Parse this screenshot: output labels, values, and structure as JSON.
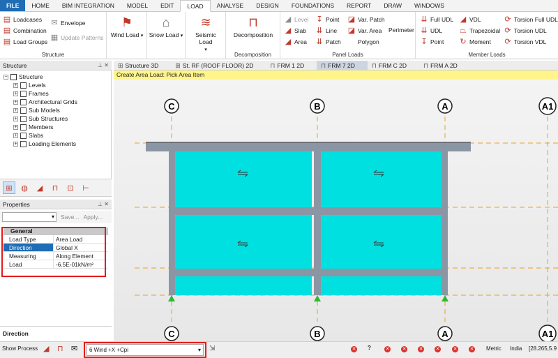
{
  "tabs": [
    "FILE",
    "HOME",
    "BIM INTEGRATION",
    "MODEL",
    "EDIT",
    "LOAD",
    "ANALYSE",
    "DESIGN",
    "FOUNDATIONS",
    "REPORT",
    "DRAW",
    "WINDOWS"
  ],
  "ribbon": {
    "structure": {
      "label": "Structure",
      "loadcases": "Loadcases",
      "combination": "Combination",
      "load_groups": "Load Groups",
      "envelope": "Envelope",
      "update_patterns": "Update Patterns"
    },
    "wind_load": "Wind Load",
    "snow_load": "Snow Load",
    "seismic_load": "Seismic Load",
    "decomposition": {
      "label": "Decomposition",
      "button": "Decomposition"
    },
    "panel_loads": {
      "label": "Panel Loads",
      "level": "Level",
      "slab": "Slab",
      "area": "Area",
      "point": "Point",
      "line": "Line",
      "patch": "Patch",
      "var_patch": "Var. Patch",
      "var_area": "Var. Area",
      "polygon": "Polygon",
      "perimeter": "Perimeter"
    },
    "member_loads": {
      "label": "Member Loads",
      "full_udl": "Full UDL",
      "udl": "UDL",
      "point": "Point",
      "vdl": "VDL",
      "trapezoidal": "Trapezoidal",
      "moment": "Moment",
      "torsion_full_udl": "Torsion Full UDL",
      "torsion_udl": "Torsion UDL",
      "torsion_vdl": "Torsion VDL"
    }
  },
  "structure_panel": {
    "title": "Structure",
    "root": "Structure",
    "items": [
      "Levels",
      "Frames",
      "Architectural Grids",
      "Sub Models",
      "Sub Structures",
      "Members",
      "Slabs",
      "Loading Elements"
    ]
  },
  "properties": {
    "title": "Properties",
    "save": "Save...",
    "apply": "Apply...",
    "group": "General",
    "rows": [
      {
        "key": "Load Type",
        "value": "Area Load"
      },
      {
        "key": "Direction",
        "value": "Global X"
      },
      {
        "key": "Measuring",
        "value": "Along Element"
      },
      {
        "key": "Load",
        "value": "-6.5E-01kN/m²"
      }
    ],
    "description_title": "Direction"
  },
  "doc_tabs": [
    "Structure 3D",
    "St. RF (ROOF FLOOR) 2D",
    "FRM 1 2D",
    "FRM 7 2D",
    "FRM C 2D",
    "FRM A 2D"
  ],
  "active_doc_tab": "FRM 7 2D",
  "hint": "Create Area Load: Pick Area Item",
  "grid_labels": [
    "C",
    "B",
    "A",
    "A1"
  ],
  "status": {
    "show_process": "Show Process",
    "loadcase": "6 Wind +X +Cpi",
    "help": "?",
    "units": "Metric",
    "code": "India",
    "coords": "[28.265,5.9"
  },
  "colors": {
    "panel": "#00e0e0",
    "frame": "#8b96a5",
    "grid_line": "#f0a020",
    "support": "#2eb82e",
    "highlight": "#e31b1b"
  }
}
